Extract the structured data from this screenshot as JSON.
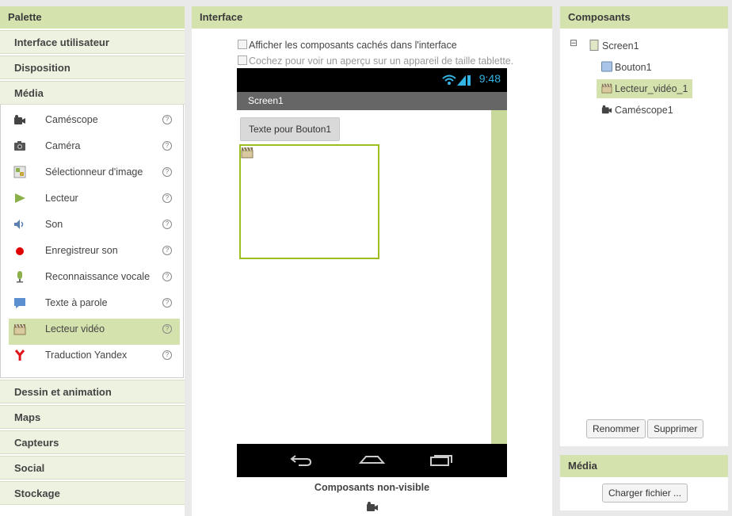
{
  "palette": {
    "title": "Palette",
    "categories_top": [
      "Interface utilisateur",
      "Disposition",
      "Média"
    ],
    "media_items": [
      {
        "label": "Caméscope",
        "icon": "camcorder-icon"
      },
      {
        "label": "Caméra",
        "icon": "camera-icon"
      },
      {
        "label": "Sélectionneur d'image",
        "icon": "image-picker-icon"
      },
      {
        "label": "Lecteur",
        "icon": "play-icon"
      },
      {
        "label": "Son",
        "icon": "speaker-icon"
      },
      {
        "label": "Enregistreur son",
        "icon": "record-icon"
      },
      {
        "label": "Reconnaissance vocale",
        "icon": "microphone-icon"
      },
      {
        "label": "Texte à parole",
        "icon": "speech-bubble-icon"
      },
      {
        "label": "Lecteur vidéo",
        "icon": "clapperboard-icon",
        "selected": true
      },
      {
        "label": "Traduction Yandex",
        "icon": "yandex-icon"
      }
    ],
    "help_glyph": "?",
    "categories_bottom": [
      "Dessin et animation",
      "Maps",
      "Capteurs",
      "Social",
      "Stockage"
    ]
  },
  "interface": {
    "title": "Interface",
    "show_hidden_label": "Afficher les composants cachés dans l'interface",
    "tablet_preview_label": "Cochez pour voir un aperçu sur un appareil de taille tablette.",
    "phone": {
      "time": "9:48",
      "screen_title": "Screen1",
      "button_text": "Texte pour Bouton1"
    },
    "nonvisible_label": "Composants non-visible"
  },
  "components": {
    "title": "Composants",
    "tree": {
      "collapse_glyph": "⊟",
      "root": "Screen1",
      "children": [
        "Bouton1",
        "Lecteur_vidéo_1",
        "Caméscope1"
      ]
    },
    "rename_label": "Renommer",
    "delete_label": "Supprimer"
  },
  "media_panel": {
    "title": "Média",
    "upload_label": "Charger fichier ..."
  },
  "colors": {
    "header_green": "#d4e2ad",
    "accent_green": "#9cbe1f",
    "status_blue": "#33b5e5"
  }
}
